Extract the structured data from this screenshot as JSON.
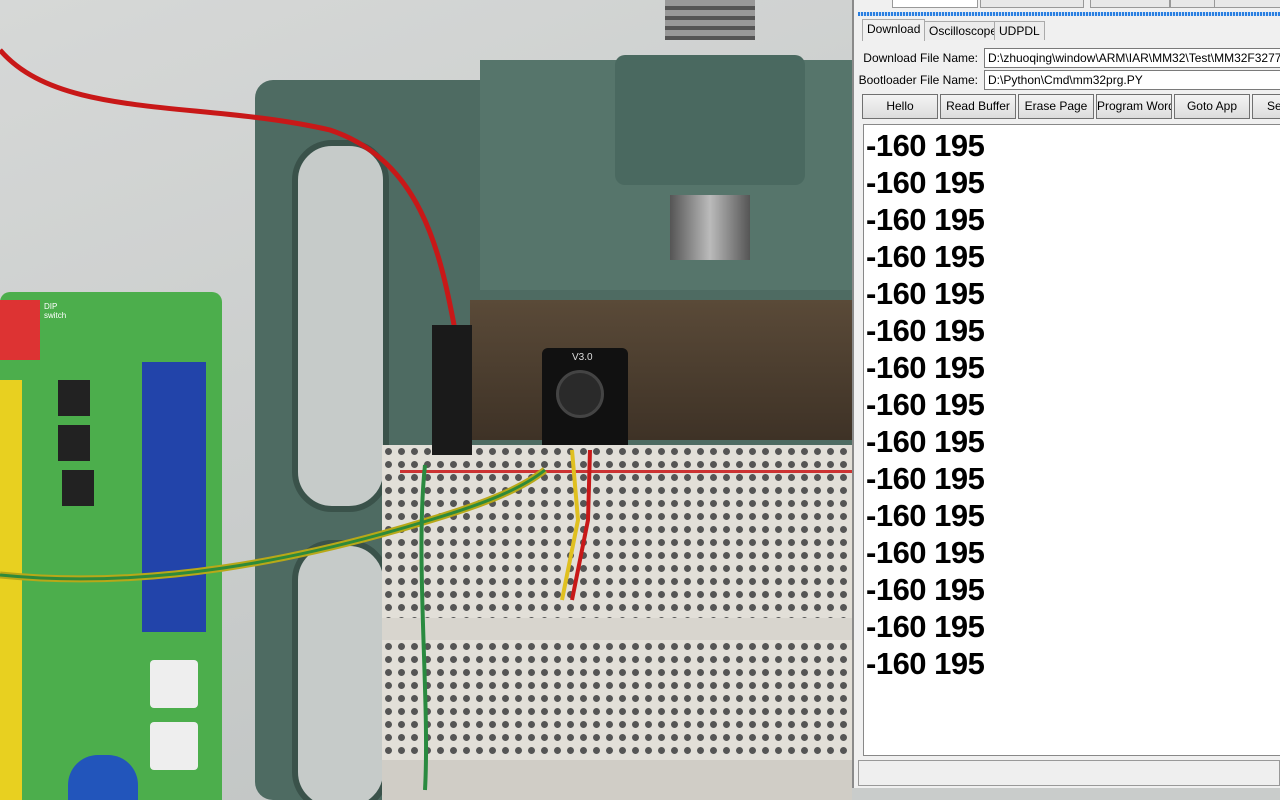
{
  "tabs": [
    {
      "label": "Download",
      "active": true
    },
    {
      "label": "Oscilloscope",
      "active": false
    },
    {
      "label": "UDPDL",
      "active": false
    }
  ],
  "download_file": {
    "label": "Download File Name:",
    "value": "D:\\zhuoqing\\window\\ARM\\IAR\\MM32\\Test\\MM32F3277\\Te"
  },
  "bootloader_file": {
    "label": "Bootloader File Name:",
    "value": "D:\\Python\\Cmd\\mm32prg.PY"
  },
  "buttons": [
    "Hello",
    "Read Buffer",
    "Erase Page",
    "Program Word",
    "Goto App",
    "Se"
  ],
  "output_lines": [
    "-160 195",
    "-160 195",
    "-160 195",
    "-160 195",
    "-160 195",
    "-160 195",
    "-160 195",
    "-160 195",
    "-160 195",
    "-160 195",
    "-160 195",
    "-160 195",
    "-160 195",
    "-160 195",
    "-160 195"
  ],
  "photo": {
    "module_label": "V3.0",
    "board_label": "DIP switch"
  },
  "colors": {
    "accent": "#2a7fe0",
    "vise": "#4e6b62",
    "breadboard": "#e2dfd8",
    "pcb": "#4cae4c"
  }
}
